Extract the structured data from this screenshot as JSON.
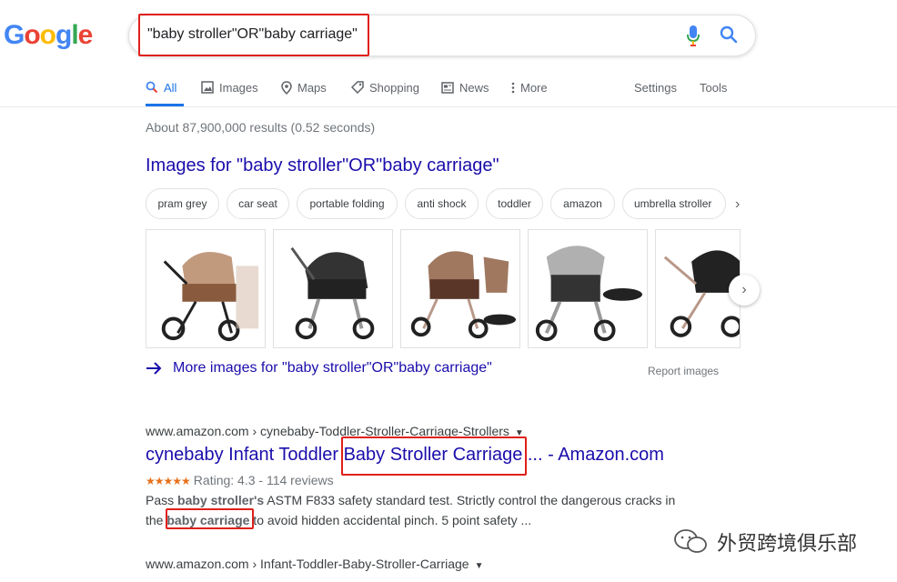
{
  "logo": {
    "letters": [
      "G",
      "o",
      "o",
      "g",
      "l",
      "e"
    ]
  },
  "search": {
    "query": "\"baby stroller\"OR\"baby carriage\""
  },
  "tabs": {
    "all": "All",
    "images": "Images",
    "maps": "Maps",
    "shopping": "Shopping",
    "news": "News",
    "more": "More",
    "settings": "Settings",
    "tools": "Tools"
  },
  "stats": "About 87,900,000 results (0.52 seconds)",
  "images_section": {
    "heading": "Images for \"baby stroller\"OR\"baby carriage\"",
    "chips": [
      "pram grey",
      "car seat",
      "portable folding",
      "anti shock",
      "toddler",
      "amazon",
      "umbrella stroller"
    ],
    "more_link": "More images for \"baby stroller\"OR\"baby carriage\"",
    "report": "Report images"
  },
  "results": [
    {
      "cite": "www.amazon.com › cynebaby-Toddler-Stroller-Carriage-Strollers",
      "title_pre": "cynebaby Infant Toddler ",
      "title_hl": "Baby Stroller Carriage",
      "title_post": " ... - Amazon.com",
      "stars": "★★★★★",
      "rating": "Rating: 4.3 - 114 reviews",
      "snippet1_pre": "Pass ",
      "snippet1_bold": "baby stroller's",
      "snippet1_post": " ASTM F833 safety standard test. Strictly control the dangerous cracks in",
      "snippet2_pre": "the ",
      "snippet2_bold": "baby carriage",
      "snippet2_post": " to avoid hidden accidental pinch. 5 point safety ..."
    },
    {
      "cite": "www.amazon.com › Infant-Toddler-Baby-Stroller-Carriage"
    }
  ],
  "watermark": {
    "text": "外贸跨境俱乐部"
  },
  "colors": {
    "link": "#1a0dab",
    "accent": "#1a73e8",
    "highlight": "#e0201b",
    "star": "#e7711b"
  }
}
